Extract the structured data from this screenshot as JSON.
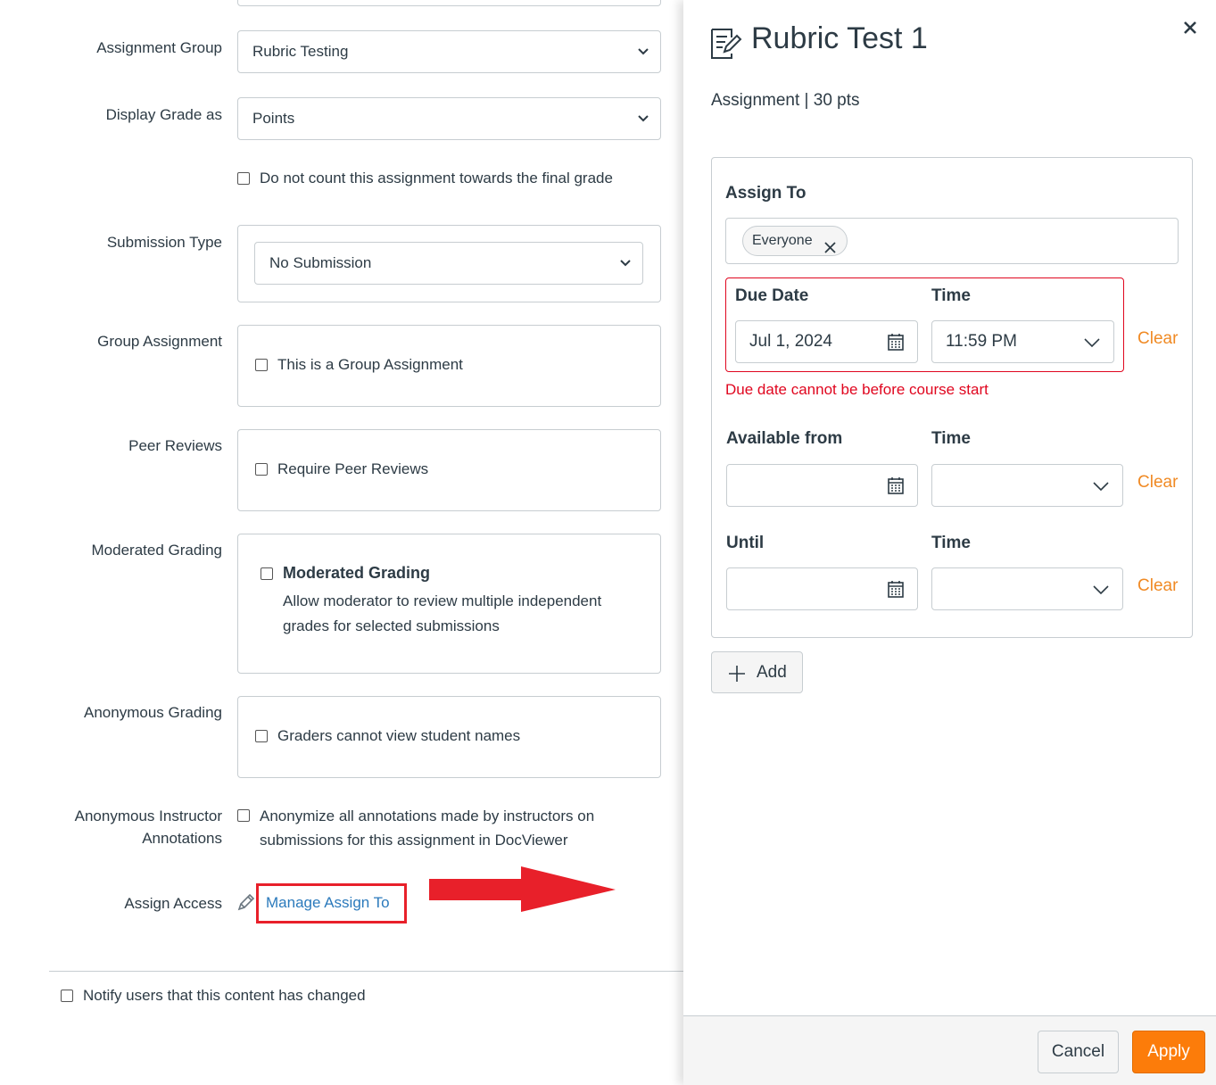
{
  "form": {
    "assignment_group": {
      "label": "Assignment Group",
      "value": "Rubric Testing"
    },
    "display_grade": {
      "label": "Display Grade as",
      "value": "Points"
    },
    "no_count_label": "Do not count this assignment towards the final grade",
    "submission_type": {
      "label": "Submission Type",
      "value": "No Submission"
    },
    "group_assignment": {
      "label": "Group Assignment",
      "checkbox": "This is a Group Assignment"
    },
    "peer_reviews": {
      "label": "Peer Reviews",
      "checkbox": "Require Peer Reviews"
    },
    "moderated_grading": {
      "label": "Moderated Grading",
      "checkbox": "Moderated Grading",
      "description": "Allow moderator to review multiple independent grades for selected submissions"
    },
    "anonymous_grading": {
      "label": "Anonymous Grading",
      "checkbox": "Graders cannot view student names"
    },
    "anon_annotations": {
      "label_line1": "Anonymous Instructor",
      "label_line2": "Annotations",
      "checkbox_line1": "Anonymize all annotations made by instructors on",
      "checkbox_line2": "submissions for this assignment in DocViewer"
    },
    "assign_access": {
      "label": "Assign Access",
      "link": "Manage Assign To"
    },
    "notify_label": "Notify users that this content has changed"
  },
  "tray": {
    "title": "Rubric Test 1",
    "subtitle": "Assignment | 30 pts",
    "assign_to_label": "Assign To",
    "assignee_pill": "Everyone",
    "due_date": {
      "label": "Due Date",
      "value": "Jul 1, 2024"
    },
    "due_time": {
      "label": "Time",
      "value": "11:59 PM"
    },
    "due_error": "Due date cannot be before course start",
    "available_from": {
      "label": "Available from",
      "value": ""
    },
    "available_time": {
      "label": "Time",
      "value": ""
    },
    "until": {
      "label": "Until",
      "value": ""
    },
    "until_time": {
      "label": "Time",
      "value": ""
    },
    "clear_label": "Clear",
    "add_label": "Add",
    "cancel_label": "Cancel",
    "apply_label": "Apply"
  },
  "colors": {
    "accent_orange": "#f08a24",
    "apply_button": "#fc7c0a",
    "error_red": "#e0061f",
    "link_blue": "#2b7abc",
    "annotation_red": "#e8202a"
  },
  "icons": [
    "assignment-edit-icon",
    "close-icon",
    "chevron-down-icon",
    "calendar-icon",
    "plus-icon",
    "pencil-icon",
    "remove-x-icon"
  ]
}
